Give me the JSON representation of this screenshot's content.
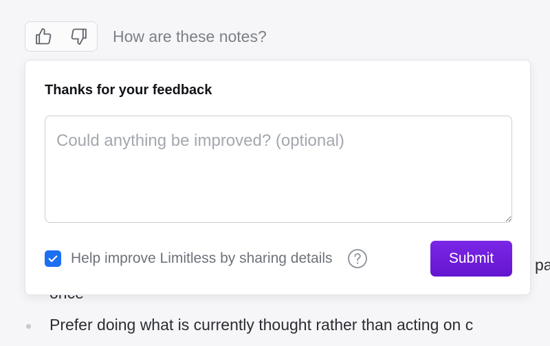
{
  "rating": {
    "question": "How are these notes?",
    "thumbs_up_icon": "thumbs-up-icon",
    "thumbs_down_icon": "thumbs-down-icon"
  },
  "popover": {
    "title": "Thanks for your feedback",
    "textarea_placeholder": "Could anything be improved? (optional)",
    "textarea_value": "",
    "share_checkbox_checked": true,
    "share_label": "Help improve Limitless by sharing details",
    "help_icon": "question-circle-icon",
    "submit_label": "Submit"
  },
  "notes": {
    "partial_right": "pa",
    "partial_below": "once",
    "bullet_text": "Prefer doing what is currently thought rather than acting on c"
  },
  "colors": {
    "accent_purple": "#6d1ed9",
    "checkbox_blue": "#1d6ff2",
    "page_background": "#f6f6f8"
  }
}
